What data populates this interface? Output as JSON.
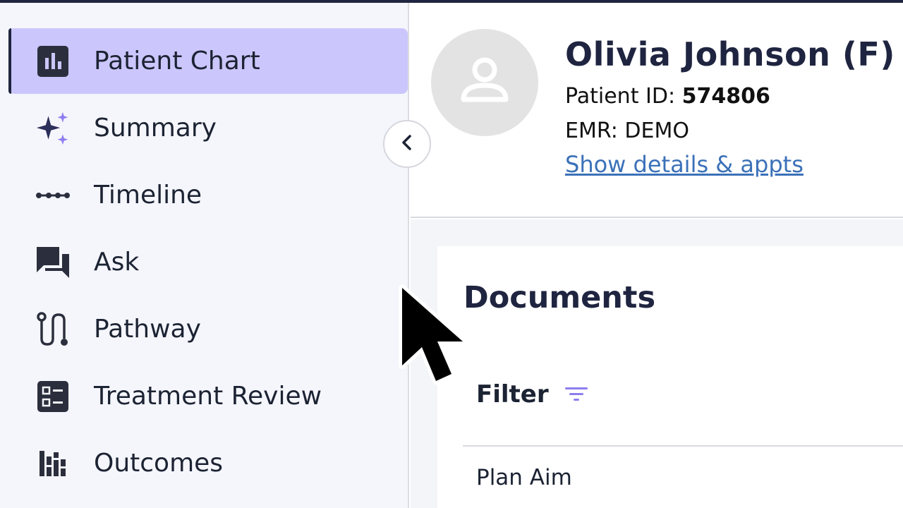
{
  "sidebar": {
    "items": [
      {
        "label": "Patient Chart",
        "icon": "bar-chart-icon",
        "active": true
      },
      {
        "label": "Summary",
        "icon": "sparkles-icon"
      },
      {
        "label": "Timeline",
        "icon": "timeline-dots-icon"
      },
      {
        "label": "Ask",
        "icon": "chat-bubbles-icon"
      },
      {
        "label": "Pathway",
        "icon": "pathway-icon"
      },
      {
        "label": "Treatment Review",
        "icon": "list-board-icon"
      },
      {
        "label": "Outcomes",
        "icon": "stacked-bars-icon"
      }
    ],
    "collapse_icon": "chevron-left-icon"
  },
  "patient": {
    "name": "Olivia Johnson (F)",
    "id_label": "Patient ID:",
    "id_value": "574806",
    "emr": "EMR: DEMO",
    "details_link": "Show details & appts",
    "avatar_icon": "person-icon"
  },
  "documents": {
    "title": "Documents",
    "filter_label": "Filter",
    "filter_icon": "filter-lines-icon",
    "rows": [
      "Plan Aim"
    ]
  },
  "colors": {
    "active_bg": "#cbc6fb",
    "accent": "#8c7ef0",
    "navy": "#1f2540",
    "link": "#3b71b8"
  }
}
